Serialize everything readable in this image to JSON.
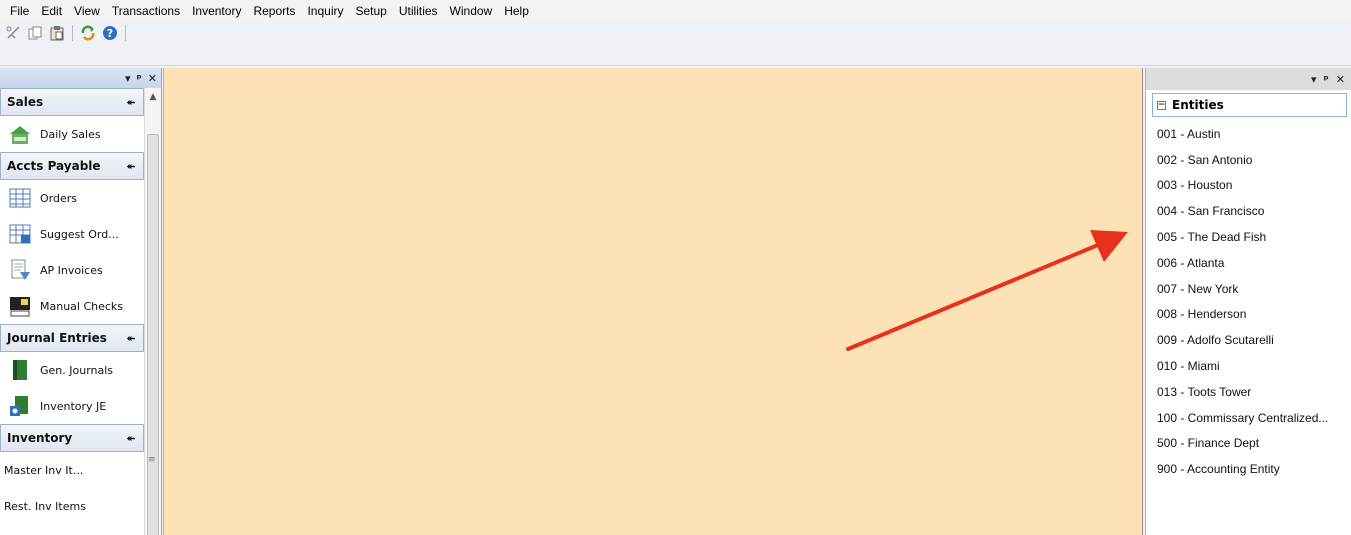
{
  "menubar": {
    "items": [
      "File",
      "Edit",
      "View",
      "Transactions",
      "Inventory",
      "Reports",
      "Inquiry",
      "Setup",
      "Utilities",
      "Window",
      "Help"
    ]
  },
  "toolbar": {
    "icons": [
      "cut-icon",
      "copy-icon",
      "paste-icon",
      "refresh-icon",
      "help-icon"
    ]
  },
  "left_panel": {
    "caption_glyphs": [
      "▾",
      "ᵖ",
      "✕"
    ],
    "groups": [
      {
        "title": "Sales",
        "items": [
          {
            "label": "Daily Sales",
            "icon": "daily-sales-icon"
          }
        ]
      },
      {
        "title": "Accts Payable",
        "items": [
          {
            "label": "Orders",
            "icon": "orders-icon"
          },
          {
            "label": "Suggest Ord...",
            "icon": "suggest-order-icon"
          },
          {
            "label": "AP Invoices",
            "icon": "ap-invoices-icon"
          },
          {
            "label": "Manual Checks",
            "icon": "manual-checks-icon"
          }
        ]
      },
      {
        "title": "Journal Entries",
        "items": [
          {
            "label": "Gen. Journals",
            "icon": "gen-journals-icon"
          },
          {
            "label": "Inventory JE",
            "icon": "inventory-je-icon"
          }
        ]
      },
      {
        "title": "Inventory",
        "items": [
          {
            "label": "Master Inv It..."
          },
          {
            "label": "Rest. Inv Items"
          }
        ]
      }
    ]
  },
  "right_panel": {
    "caption_glyphs": [
      "▾",
      "ᵖ",
      "✕"
    ],
    "tree_title": "Entities",
    "entities": [
      "001 - Austin",
      "002 - San Antonio",
      "003 - Houston",
      "004 - San Francisco",
      "005 - The Dead Fish",
      "006 - Atlanta",
      "007 - New York",
      "008 - Henderson",
      "009 - Adolfo Scutarelli",
      "010 - Miami",
      "013 - Toots Tower",
      "100 - Commissary Centralized...",
      "500 - Finance Dept",
      "900 - Accounting Entity"
    ]
  },
  "colors": {
    "workspace": "#fce2b4",
    "arrow": "#e8311c",
    "group_border": "#9ab0cc"
  }
}
